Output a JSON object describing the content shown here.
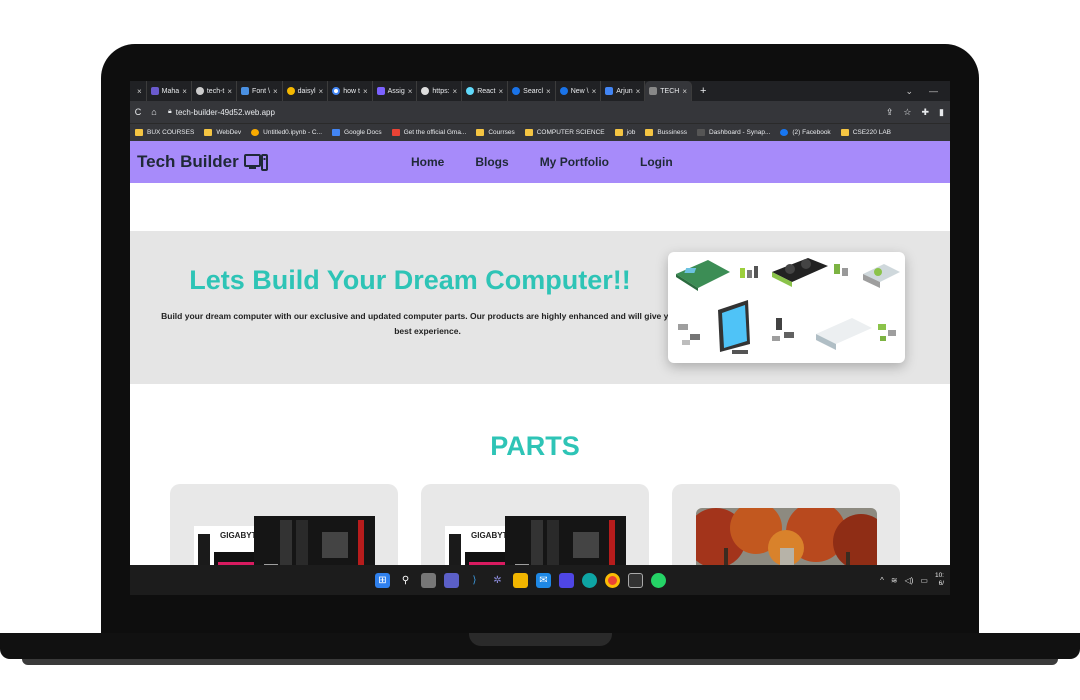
{
  "browser": {
    "tabs": [
      {
        "label": "",
        "color": "#9aa0a6"
      },
      {
        "label": "Maha",
        "color": "#6a5acd"
      },
      {
        "label": "tech-t",
        "color": "#cccccc"
      },
      {
        "label": "Font \\",
        "color": "#4a90e2"
      },
      {
        "label": "daisyl",
        "color": "#f5b800"
      },
      {
        "label": "how t",
        "color": "#4285f4"
      },
      {
        "label": "Assig",
        "color": "#7b61ff"
      },
      {
        "label": "https:",
        "color": "#dddddd"
      },
      {
        "label": "React",
        "color": "#61dafb"
      },
      {
        "label": "Searcl",
        "color": "#1a73e8"
      },
      {
        "label": "New \\",
        "color": "#1a73e8"
      },
      {
        "label": "Arjun",
        "color": "#4285f4"
      },
      {
        "label": "TECH",
        "color": "#888888"
      }
    ],
    "new_tab": "+",
    "url": "tech-builder-49d52.web.app",
    "bookmarks": [
      {
        "label": "BUX COURSES"
      },
      {
        "label": "WebDev"
      },
      {
        "label": "Untitled0.ipynb - C..."
      },
      {
        "label": "Google Docs"
      },
      {
        "label": "Get the official Gma..."
      },
      {
        "label": "Courrses"
      },
      {
        "label": "COMPUTER SCIENCE"
      },
      {
        "label": "job"
      },
      {
        "label": "Bussiness"
      },
      {
        "label": "Dashboard - Synap..."
      },
      {
        "label": "(2) Facebook"
      },
      {
        "label": "CSE220 LAB"
      }
    ]
  },
  "site": {
    "brand": "Tech Builder",
    "nav": [
      "Home",
      "Blogs",
      "My Portfolio",
      "Login"
    ],
    "hero_title": "Lets Build Your Dream Computer!!",
    "hero_text": "Build your dream computer with our exclusive and updated computer parts. Our products are highly enhanced and will give you the best experience.",
    "parts_title": "PARTS",
    "card_brand": "GIGABYTE"
  },
  "taskbar": {
    "clock_time": "10:",
    "clock_date": "6/"
  },
  "colors": {
    "accent": "#2ec4b6",
    "navbar": "#a78bfa"
  }
}
